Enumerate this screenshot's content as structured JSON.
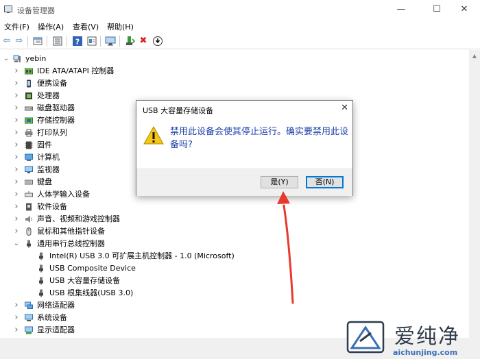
{
  "window": {
    "title": "设备管理器",
    "minimize": "—",
    "maximize": "☐",
    "close": "✕"
  },
  "menu": [
    "文件(F)",
    "操作(A)",
    "查看(V)",
    "帮助(H)"
  ],
  "toolbar": {
    "back": "⇦",
    "forward": "⇨",
    "disable": "✖",
    "update": "⬇"
  },
  "tree": {
    "root": "yebin",
    "rows": [
      {
        "label": "IDE ATA/ATAPI 控制器",
        "icon": "ide-controller-icon",
        "expanded": false,
        "depth": 1
      },
      {
        "label": "便携设备",
        "icon": "portable-device-icon",
        "expanded": false,
        "depth": 1
      },
      {
        "label": "处理器",
        "icon": "processor-icon",
        "expanded": false,
        "depth": 1
      },
      {
        "label": "磁盘驱动器",
        "icon": "disk-drive-icon",
        "expanded": false,
        "depth": 1
      },
      {
        "label": "存储控制器",
        "icon": "storage-controller-icon",
        "expanded": false,
        "depth": 1
      },
      {
        "label": "打印队列",
        "icon": "printer-icon",
        "expanded": false,
        "depth": 1
      },
      {
        "label": "固件",
        "icon": "firmware-icon",
        "expanded": false,
        "depth": 1
      },
      {
        "label": "计算机",
        "icon": "computer-icon",
        "expanded": false,
        "depth": 1
      },
      {
        "label": "监视器",
        "icon": "monitor-icon",
        "expanded": false,
        "depth": 1
      },
      {
        "label": "键盘",
        "icon": "keyboard-icon",
        "expanded": false,
        "depth": 1
      },
      {
        "label": "人体学输入设备",
        "icon": "hid-icon",
        "expanded": false,
        "depth": 1
      },
      {
        "label": "软件设备",
        "icon": "software-device-icon",
        "expanded": false,
        "depth": 1
      },
      {
        "label": "声音、视频和游戏控制器",
        "icon": "sound-icon",
        "expanded": false,
        "depth": 1
      },
      {
        "label": "鼠标和其他指针设备",
        "icon": "mouse-icon",
        "expanded": false,
        "depth": 1
      },
      {
        "label": "通用串行总线控制器",
        "icon": "usb-icon",
        "expanded": true,
        "depth": 1
      },
      {
        "label": "Intel(R) USB 3.0 可扩展主机控制器 - 1.0 (Microsoft)",
        "icon": "usb-icon",
        "expanded": null,
        "depth": 2
      },
      {
        "label": "USB Composite Device",
        "icon": "usb-icon",
        "expanded": null,
        "depth": 2
      },
      {
        "label": "USB 大容量存储设备",
        "icon": "usb-icon",
        "expanded": null,
        "depth": 2
      },
      {
        "label": "USB 根集线器(USB 3.0)",
        "icon": "usb-icon",
        "expanded": null,
        "depth": 2
      },
      {
        "label": "网络适配器",
        "icon": "network-adapter-icon",
        "expanded": false,
        "depth": 1
      },
      {
        "label": "系统设备",
        "icon": "system-device-icon",
        "expanded": false,
        "depth": 1
      },
      {
        "label": "显示适配器",
        "icon": "display-adapter-icon",
        "expanded": false,
        "depth": 1
      }
    ]
  },
  "dialog": {
    "title": "USB 大容量存储设备",
    "close": "✕",
    "message": "禁用此设备会使其停止运行。确实要禁用此设备吗?",
    "yes": "是(Y)",
    "no": "否(N)"
  },
  "watermark": {
    "chinese": "爱纯净",
    "url": "aichunjing.com"
  },
  "colors": {
    "accent": "#0078d7",
    "message": "#1c3fa8",
    "arrow": "#e8392e"
  }
}
